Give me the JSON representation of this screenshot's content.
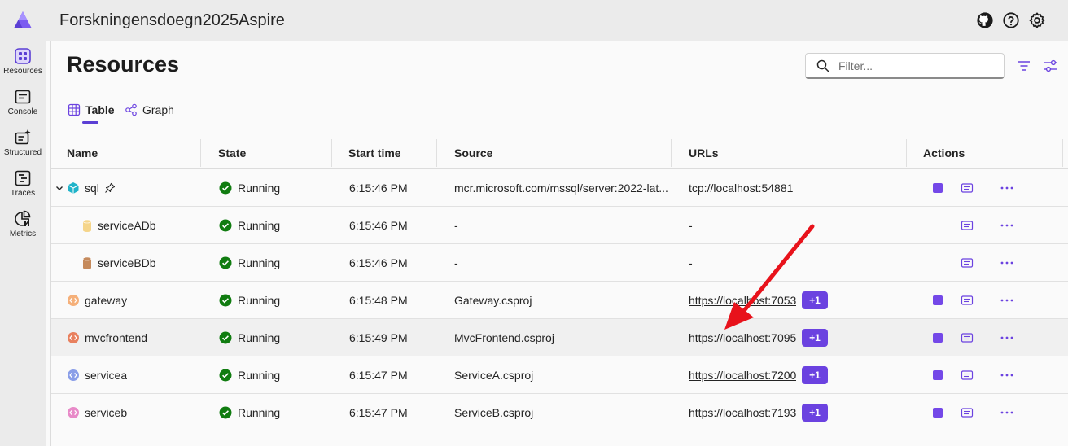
{
  "app": {
    "title": "Forskningensdoegn2025Aspire"
  },
  "sidebar": {
    "items": [
      {
        "label": "Resources",
        "icon": "grid-icon"
      },
      {
        "label": "Console",
        "icon": "console-icon"
      },
      {
        "label": "Structured",
        "icon": "structured-icon"
      },
      {
        "label": "Traces",
        "icon": "traces-icon"
      },
      {
        "label": "Metrics",
        "icon": "metrics-icon"
      }
    ]
  },
  "page": {
    "title": "Resources"
  },
  "filter": {
    "placeholder": "Filter..."
  },
  "tabs": [
    {
      "label": "Table",
      "active": true
    },
    {
      "label": "Graph",
      "active": false
    }
  ],
  "table": {
    "headers": [
      "Name",
      "State",
      "Start time",
      "Source",
      "URLs",
      "Actions"
    ],
    "rows": [
      {
        "name": "sql",
        "state": "Running",
        "start": "6:15:46 PM",
        "source": "mcr.microsoft.com/mssql/server:2022-lat...",
        "url": "tcp://localhost:54881",
        "url_link": false,
        "badge": "",
        "icon_color": "#1fb3c9",
        "stop": true
      },
      {
        "name": "serviceADb",
        "state": "Running",
        "start": "6:15:46 PM",
        "source": "-",
        "url": "-",
        "url_link": false,
        "badge": "",
        "icon_color": "#f5d58a",
        "stop": false
      },
      {
        "name": "serviceBDb",
        "state": "Running",
        "start": "6:15:46 PM",
        "source": "-",
        "url": "-",
        "url_link": false,
        "badge": "",
        "icon_color": "#c58a5c",
        "stop": false
      },
      {
        "name": "gateway",
        "state": "Running",
        "start": "6:15:48 PM",
        "source": "Gateway.csproj",
        "url": "https://localhost:7053",
        "url_link": true,
        "badge": "+1",
        "icon_color": "#f5b07a",
        "stop": true
      },
      {
        "name": "mvcfrontend",
        "state": "Running",
        "start": "6:15:49 PM",
        "source": "MvcFrontend.csproj",
        "url": "https://localhost:7095",
        "url_link": true,
        "badge": "+1",
        "icon_color": "#e8805e",
        "stop": true
      },
      {
        "name": "servicea",
        "state": "Running",
        "start": "6:15:47 PM",
        "source": "ServiceA.csproj",
        "url": "https://localhost:7200",
        "url_link": true,
        "badge": "+1",
        "icon_color": "#8a9ee8",
        "stop": true
      },
      {
        "name": "serviceb",
        "state": "Running",
        "start": "6:15:47 PM",
        "source": "ServiceB.csproj",
        "url": "https://localhost:7193",
        "url_link": true,
        "badge": "+1",
        "icon_color": "#e88ac8",
        "stop": true
      }
    ]
  },
  "colors": {
    "accent": "#6b42e0",
    "running": "#107c10",
    "annotation_arrow": "#e8121b"
  }
}
